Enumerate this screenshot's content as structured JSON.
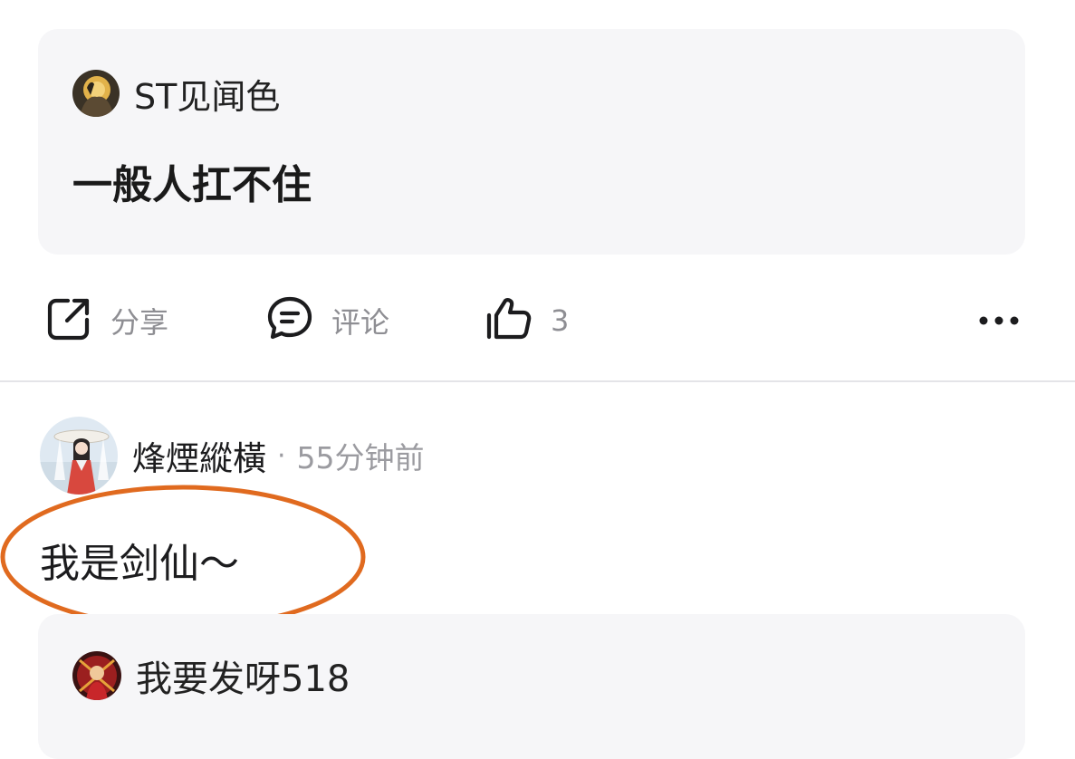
{
  "quoted_post": {
    "author": "ST见闻色",
    "text": "一般人扛不住"
  },
  "actions": {
    "share_label": "分享",
    "comment_label": "评论",
    "like_count": "3"
  },
  "comment": {
    "author": "烽煙縱橫",
    "separator": "·",
    "time": "55分钟前",
    "text": "我是剑仙～"
  },
  "reply": {
    "author": "我要发呀518"
  },
  "colors": {
    "card_bg": "#f6f6f8",
    "secondary_text": "#8e8e93",
    "annotation_circle": "#e06a1f"
  },
  "icons": [
    "share-icon",
    "comment-icon",
    "thumbs-up-icon",
    "more-icon"
  ]
}
